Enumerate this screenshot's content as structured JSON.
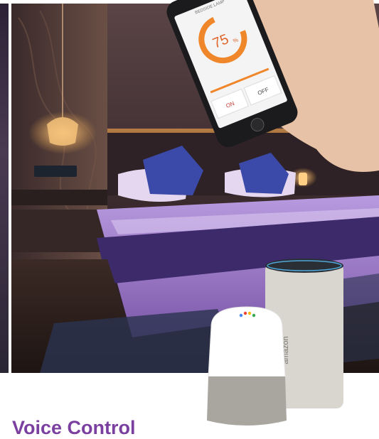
{
  "caption": {
    "text": "Voice Control"
  },
  "phone_app": {
    "header": "BEDSIDE LAMP",
    "dial_value": "75",
    "dial_unit": "%",
    "on_label": "ON",
    "off_label": "OFF"
  },
  "speaker": {
    "brand": "amazon"
  },
  "colors": {
    "caption": "#7b3fa0",
    "dial": "#f0862a",
    "bedding": "#8e63b6"
  }
}
